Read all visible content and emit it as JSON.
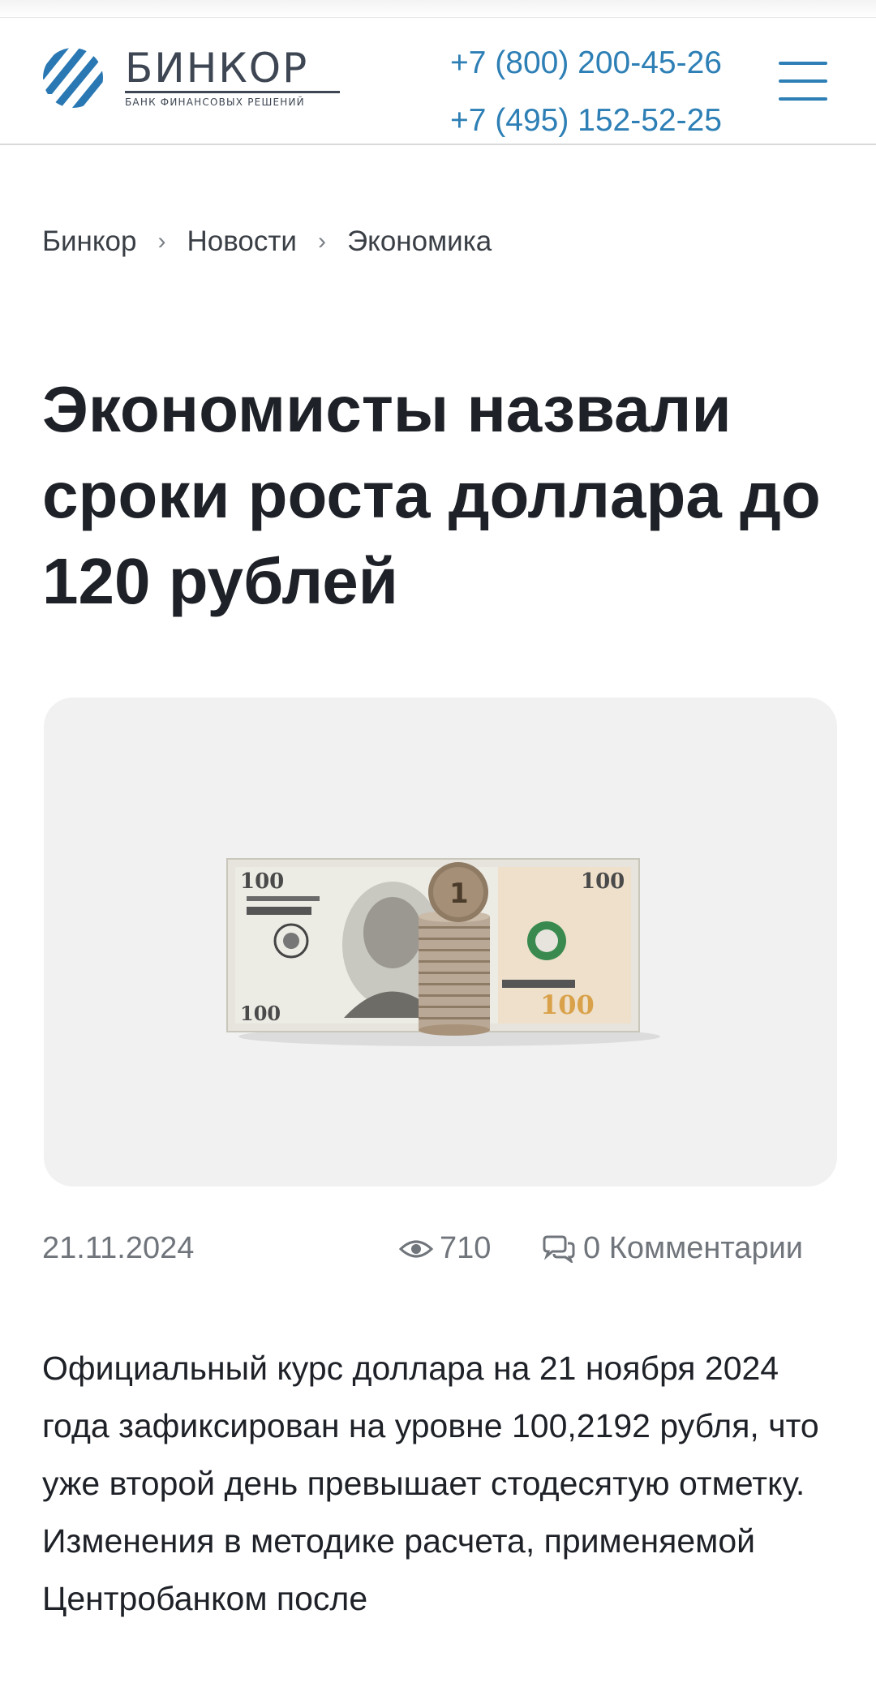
{
  "header": {
    "logo": {
      "name": "БИНКОР",
      "tagline": "БАНК ФИНАНСОВЫХ РЕШЕНИЙ",
      "icon": "binkor-logo-mark"
    },
    "phones": [
      "+7 (800) 200-45-26",
      "+7 (495) 152-52-25"
    ],
    "menu_icon": "hamburger-menu-icon"
  },
  "breadcrumb": {
    "items": [
      "Бинкор",
      "Новости",
      "Экономика"
    ],
    "separator_icon": "chevron-right-icon"
  },
  "article": {
    "title": "Экономисты назвали сроки роста доллара до 120 рублей",
    "image_icon": "dollar-bill-and-ruble-coins-image",
    "date": "21.11.2024",
    "views": "710",
    "comments": "0 Комментарии",
    "body": "Официальный курс доллара на 21 ноября 2024 года зафиксирован на уровне 100,2192 рубля, что уже второй день превышает стодесятую отметку. Изменения в методике расчета, применяемой Центробанком после"
  },
  "colors": {
    "accent": "#2d7fb5",
    "logo_text": "#3d4652",
    "title": "#1e2127",
    "meta": "#70757c",
    "image_bg": "#f1f1f1"
  }
}
